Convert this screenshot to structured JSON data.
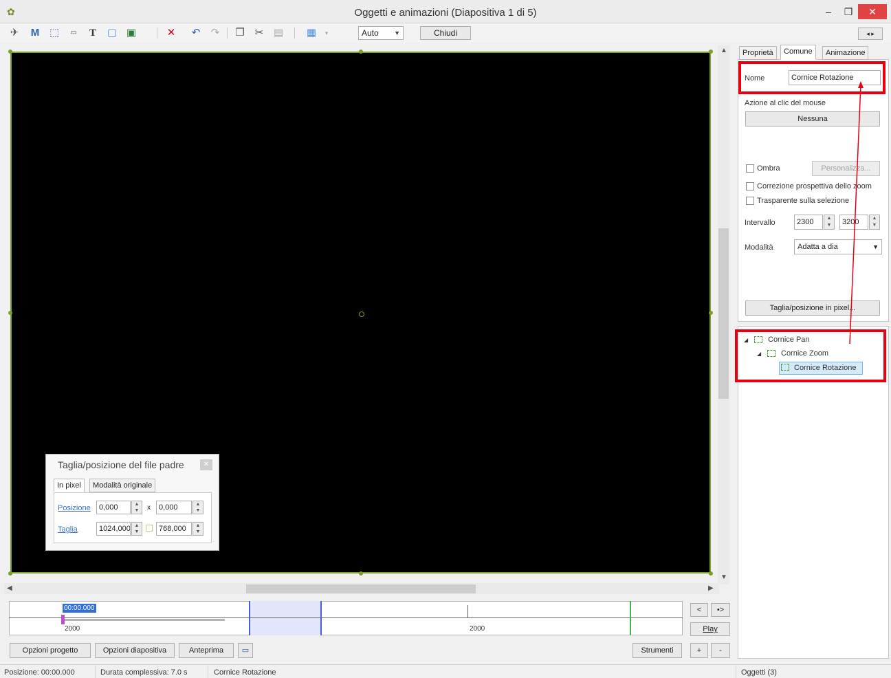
{
  "window": {
    "title": "Oggetti e animazioni  (Diapositiva 1 di 5)",
    "min": "–",
    "max": "❐",
    "close": "✕"
  },
  "toolbar": {
    "icons": [
      "camera-icon",
      "mask-icon",
      "frame-icon",
      "button-icon",
      "text-icon",
      "rectangle-icon",
      "image-icon",
      "delete-icon",
      "undo-icon",
      "redo-icon",
      "copy-icon",
      "cut-icon",
      "paste-icon",
      "grid-icon"
    ],
    "zoom_value": "Auto",
    "close_label": "Chiudi",
    "panel_toggle": "◂ ▸"
  },
  "float_dialog": {
    "title": "Taglia/posizione del file padre",
    "tabs": [
      "In pixel",
      "Modalità originale"
    ],
    "position_label": "Posizione",
    "pos_x": "0,000",
    "sep_x": "x",
    "pos_y": "0,000",
    "size_label": "Taglia",
    "size_w": "1024,000",
    "size_h": "768,000"
  },
  "timeline": {
    "current_time": "00:00.000",
    "label_left": "2000",
    "label_right": "2000",
    "nav_prev": "<",
    "nav_next": "•>",
    "play_label": "Play",
    "add_label": "+",
    "remove_label": "-"
  },
  "bottom_buttons": {
    "project_options": "Opzioni progetto",
    "slide_options": "Opzioni diapositiva",
    "preview": "Anteprima",
    "tools": "Strumenti"
  },
  "status": {
    "position": "Posizione:  00:00.000",
    "duration": "Durata complessiva:  7.0 s",
    "object_name": "Cornice Rotazione",
    "objects_count": "Oggetti (3)"
  },
  "right_panel": {
    "tabs": [
      "Proprietà",
      "Comune",
      "Animazione"
    ],
    "name_label": "Nome",
    "name_value": "Cornice Rotazione",
    "mouse_action_label": "Azione al clic del mouse",
    "mouse_action_value": "Nessuna",
    "shadow_label": "Ombra",
    "customize_label": "Personalizza...",
    "perspective_label": "Correzione prospettiva dello zoom",
    "transparent_label": "Trasparente sulla selezione",
    "interval_label": "Intervallo",
    "interval_from": "2300",
    "interval_to": "3200",
    "mode_label": "Modalità",
    "mode_value": "Adatta a dia",
    "crop_button": "Taglia/posizione in pixel..."
  },
  "tree": {
    "items": [
      "Cornice Pan",
      "Cornice Zoom",
      "Cornice Rotazione"
    ]
  },
  "colors": {
    "highlight": "#e8000f",
    "frame_green": "#7ca02e",
    "selection_blue": "#4b5fd8"
  }
}
